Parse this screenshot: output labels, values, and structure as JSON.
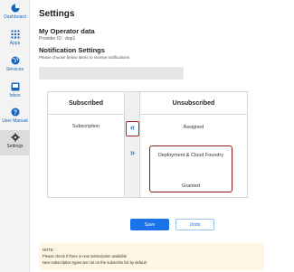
{
  "sidebar": {
    "items": [
      {
        "label": "Dashboard",
        "icon": "pie-chart-icon"
      },
      {
        "label": "Apps",
        "icon": "grid-icon"
      },
      {
        "label": "Services",
        "icon": "globe-icon"
      },
      {
        "label": "Inbox",
        "icon": "inbox-icon"
      },
      {
        "label": "User Manual",
        "icon": "help-icon"
      },
      {
        "label": "Settings",
        "icon": "gear-icon",
        "active": true
      }
    ]
  },
  "page": {
    "title": "Settings",
    "operator_heading": "My Operator data",
    "provider_line": "Provider ID : dop1",
    "notification_heading": "Notification Settings",
    "notification_hint": "Please choose below items to receive notifications"
  },
  "table": {
    "subscribed_header": "Subscribed",
    "unsubscribed_header": "Unsubscribed",
    "subscribed_items": [
      "Subscription"
    ],
    "unsubscribed_items": [
      "Assigned",
      "Deployment & Cloud Foundry",
      "Granted"
    ],
    "move_left_glyph": "«",
    "move_right_glyph": "»"
  },
  "actions": {
    "save_label": "Save",
    "undo_label": "Undo"
  },
  "note": {
    "title": "NOTE:",
    "lines": [
      "Please check if there is new subscription available",
      "New subscription types are not on the subscribe list by default"
    ]
  },
  "colors": {
    "accent": "#1a73e8",
    "highlight_border": "#b22222",
    "note_background": "#fdf6e3"
  }
}
